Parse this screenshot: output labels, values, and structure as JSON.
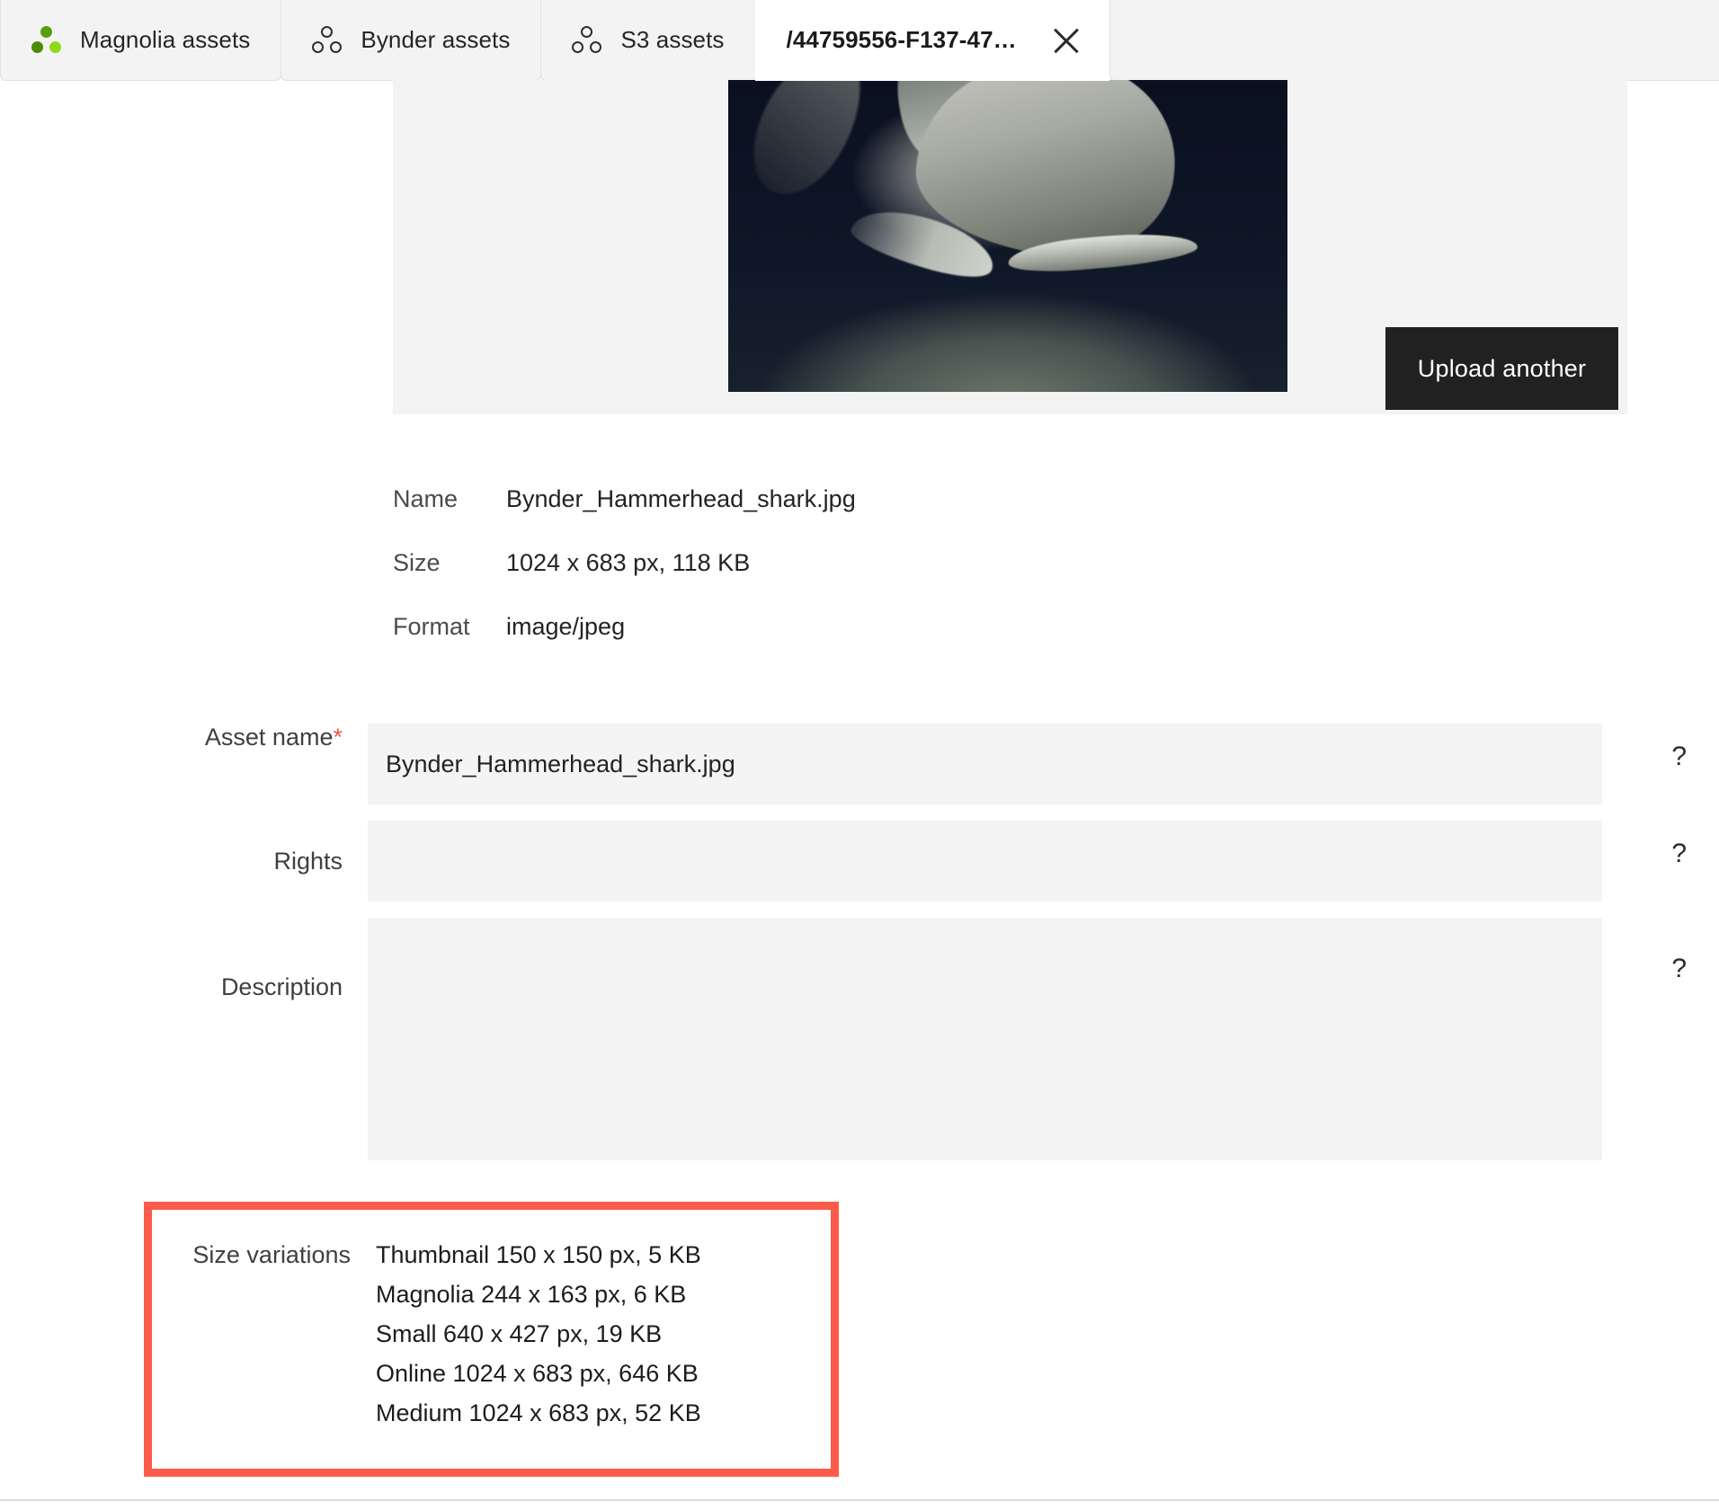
{
  "tabs": [
    {
      "label": "Magnolia assets",
      "icon": "magnolia-dots-icon",
      "active": false,
      "closable": false
    },
    {
      "label": "Bynder assets",
      "icon": "three-circles-outline-icon",
      "active": false,
      "closable": false
    },
    {
      "label": "S3 assets",
      "icon": "three-circles-outline-icon",
      "active": false,
      "closable": false
    },
    {
      "label": "/44759556-F137-47…",
      "icon": "",
      "active": true,
      "closable": true
    }
  ],
  "preview": {
    "image_alt": "hammerhead-shark-underwater-photo",
    "upload_button_label": "Upload another"
  },
  "metadata": [
    {
      "key": "Name",
      "value": "Bynder_Hammerhead_shark.jpg"
    },
    {
      "key": "Size",
      "value": "1024 x 683 px, 118 KB"
    },
    {
      "key": "Format",
      "value": "image/jpeg"
    }
  ],
  "form": {
    "asset_name": {
      "label": "Asset name",
      "required_marker": "*",
      "value": "Bynder_Hammerhead_shark.jpg",
      "placeholder": "",
      "help": "?"
    },
    "rights": {
      "label": "Rights",
      "value": "",
      "placeholder": "",
      "help": "?"
    },
    "description": {
      "label": "Description",
      "value": "",
      "placeholder": "",
      "help": "?"
    }
  },
  "size_variations": {
    "label": "Size variations",
    "items": [
      "Thumbnail 150 x 150 px, 5 KB",
      "Magnolia 244 x 163 px, 6 KB",
      "Small 640 x 427 px, 19 KB",
      "Online 1024 x 683 px, 646 KB",
      "Medium 1024 x 683 px, 52 KB"
    ]
  },
  "colors": {
    "highlight_box": "#fb5c4c",
    "accent_green_dark": "#4e8b05",
    "accent_green_light": "#8ddb16",
    "button_bg": "#212121",
    "field_bg": "#f4f4f4",
    "required_red": "#e8574b"
  }
}
